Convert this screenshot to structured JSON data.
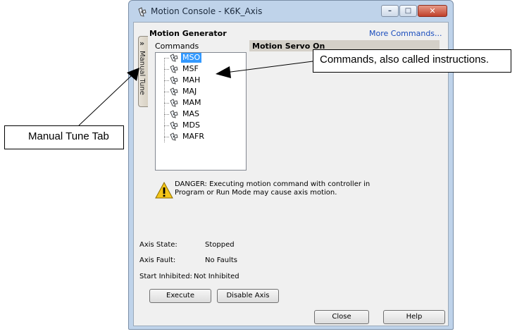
{
  "window": {
    "title": "Motion Console - K6K_Axis",
    "controls": {
      "minimize": "–",
      "maximize": "□",
      "close": "✕"
    }
  },
  "side_tab": {
    "label": "Manual Tune",
    "chevron": "»"
  },
  "panel": {
    "title": "Motion Generator",
    "more_commands": "More Commands...",
    "commands_label": "Commands",
    "detail_header": "Motion Servo On"
  },
  "commands": [
    {
      "label": "MSO",
      "selected": true
    },
    {
      "label": "MSF",
      "selected": false
    },
    {
      "label": "MAH",
      "selected": false
    },
    {
      "label": "MAJ",
      "selected": false
    },
    {
      "label": "MAM",
      "selected": false
    },
    {
      "label": "MAS",
      "selected": false
    },
    {
      "label": "MDS",
      "selected": false
    },
    {
      "label": "MAFR",
      "selected": false
    }
  ],
  "warning": {
    "text": "DANGER: Executing motion command with controller in Program or Run Mode may cause axis motion."
  },
  "status": {
    "axis_state_label": "Axis State:",
    "axis_state_value": "Stopped",
    "axis_fault_label": "Axis Fault:",
    "axis_fault_value": "No Faults",
    "start_inhibited_label": "Start Inhibited:",
    "start_inhibited_value": "Not Inhibited"
  },
  "buttons": {
    "execute": "Execute",
    "disable_axis": "Disable Axis",
    "close": "Close",
    "help": "Help"
  },
  "callouts": {
    "commands": "Commands, also called instructions.",
    "manual_tune": "Manual Tune Tab"
  },
  "icons": {
    "title_icon": "motion-axis-icon",
    "command_icon": "motion-command-icon",
    "warning_icon": "warning-triangle-icon"
  }
}
